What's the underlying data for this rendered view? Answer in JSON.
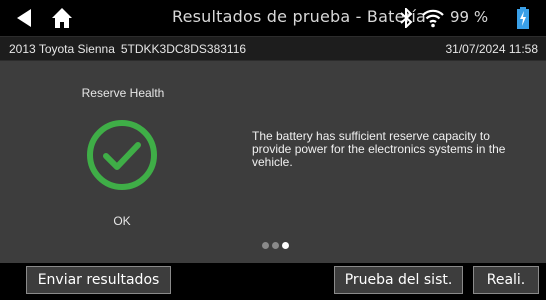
{
  "header": {
    "title": "Resultados de prueba - Batería",
    "battery_percent": "99 %",
    "icons": [
      "back-arrow-icon",
      "home-icon",
      "bluetooth-icon",
      "wifi-icon",
      "battery-charging-icon"
    ]
  },
  "info": {
    "vehicle": "2013 Toyota Sienna",
    "vin": "5TDKK3DC8DS383116",
    "datetime": "31/07/2024 11:58"
  },
  "result": {
    "label": "Reserve Health",
    "status": "OK",
    "status_color": "#3fae47",
    "message": "The battery has sufficient reserve capacity to provide power for the electronics systems in the vehicle.",
    "page_count": 3,
    "active_page": 3
  },
  "footer": {
    "send_results": "Enviar resultados",
    "system_test": "Prueba del sist.",
    "done": "Reali."
  }
}
